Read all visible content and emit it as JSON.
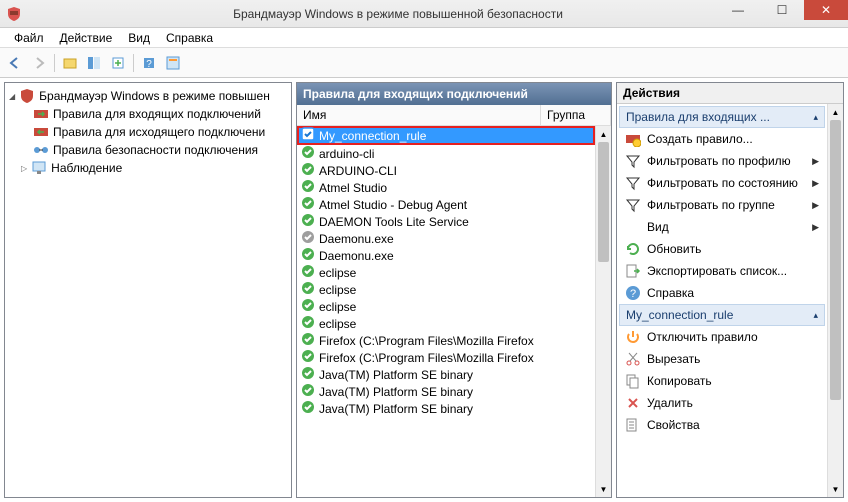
{
  "window": {
    "title": "Брандмауэр Windows в режиме повышенной безопасности"
  },
  "menu": {
    "items": [
      "Файл",
      "Действие",
      "Вид",
      "Справка"
    ]
  },
  "tree": {
    "root": "Брандмауэр Windows в режиме повышен",
    "children": [
      {
        "label": "Правила для входящих подключений",
        "icon": "inbound"
      },
      {
        "label": "Правила для исходящего подключени",
        "icon": "outbound"
      },
      {
        "label": "Правила безопасности подключения",
        "icon": "connsec"
      },
      {
        "label": "Наблюдение",
        "icon": "monitor",
        "expandable": true
      }
    ]
  },
  "center": {
    "title": "Правила для входящих подключений",
    "columns": {
      "name": "Имя",
      "group": "Группа"
    },
    "rules": [
      {
        "name": "My_connection_rule",
        "status": "blue",
        "selected": true,
        "highlighted": true
      },
      {
        "name": "arduino-cli",
        "status": "green"
      },
      {
        "name": "ARDUINO-CLI",
        "status": "green"
      },
      {
        "name": "Atmel Studio",
        "status": "green"
      },
      {
        "name": "Atmel Studio - Debug Agent",
        "status": "green"
      },
      {
        "name": "DAEMON Tools Lite Service",
        "status": "green"
      },
      {
        "name": "Daemonu.exe",
        "status": "gray"
      },
      {
        "name": "Daemonu.exe",
        "status": "green"
      },
      {
        "name": "eclipse",
        "status": "green"
      },
      {
        "name": "eclipse",
        "status": "green"
      },
      {
        "name": "eclipse",
        "status": "green"
      },
      {
        "name": "eclipse",
        "status": "green"
      },
      {
        "name": "Firefox (C:\\Program Files\\Mozilla Firefox",
        "status": "green"
      },
      {
        "name": "Firefox (C:\\Program Files\\Mozilla Firefox",
        "status": "green"
      },
      {
        "name": "Java(TM) Platform SE binary",
        "status": "green"
      },
      {
        "name": "Java(TM) Platform SE binary",
        "status": "green"
      },
      {
        "name": "Java(TM) Platform SE binary",
        "status": "green"
      }
    ]
  },
  "actions": {
    "title": "Действия",
    "groups": [
      {
        "title": "Правила для входящих ...",
        "items": [
          {
            "label": "Создать правило...",
            "icon": "new-rule"
          },
          {
            "label": "Фильтровать по профилю",
            "icon": "filter",
            "arrow": true
          },
          {
            "label": "Фильтровать по состоянию",
            "icon": "filter",
            "arrow": true
          },
          {
            "label": "Фильтровать по группе",
            "icon": "filter",
            "arrow": true
          },
          {
            "label": "Вид",
            "icon": "blank",
            "arrow": true
          },
          {
            "label": "Обновить",
            "icon": "refresh"
          },
          {
            "label": "Экспортировать список...",
            "icon": "export"
          },
          {
            "label": "Справка",
            "icon": "help"
          }
        ]
      },
      {
        "title": "My_connection_rule",
        "items": [
          {
            "label": "Отключить правило",
            "icon": "disable"
          },
          {
            "label": "Вырезать",
            "icon": "cut"
          },
          {
            "label": "Копировать",
            "icon": "copy"
          },
          {
            "label": "Удалить",
            "icon": "delete"
          },
          {
            "label": "Свойства",
            "icon": "props"
          }
        ]
      }
    ]
  }
}
